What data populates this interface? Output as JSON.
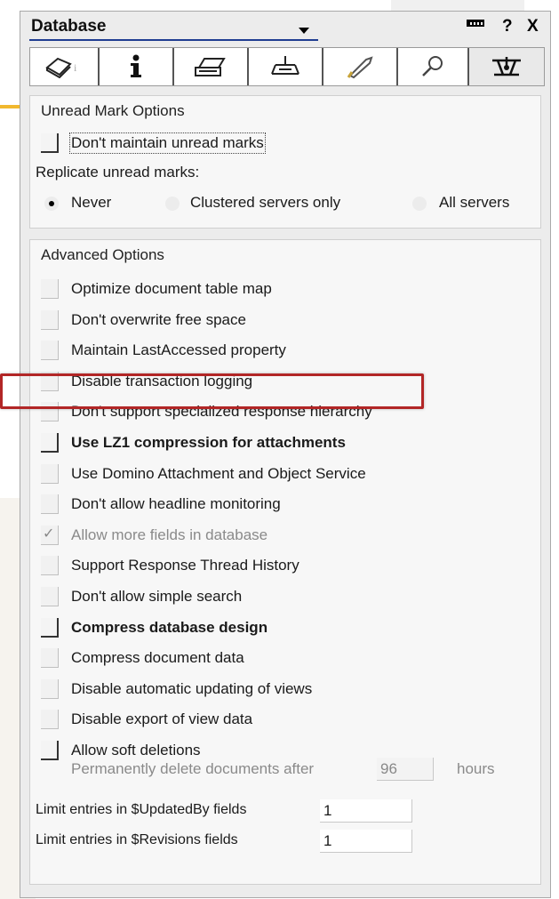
{
  "panel": {
    "title": "Database",
    "help_label": "?",
    "close_label": "X"
  },
  "tabs": [
    {
      "icon": "info-book-icon"
    },
    {
      "icon": "info-icon"
    },
    {
      "icon": "printer-icon"
    },
    {
      "icon": "design-icon"
    },
    {
      "icon": "launch-icon"
    },
    {
      "icon": "search-icon"
    },
    {
      "icon": "advanced-icon"
    }
  ],
  "unread": {
    "title": "Unread Mark Options",
    "dont_maintain": "Don't maintain unread marks",
    "replicate_label": "Replicate unread marks:",
    "radio_never": "Never",
    "radio_clustered": "Clustered servers only",
    "radio_all": "All servers",
    "selected": "Never"
  },
  "advanced": {
    "title": "Advanced Options",
    "options": [
      {
        "label": "Optimize document table map",
        "checked": false,
        "bold": false,
        "disabled": false
      },
      {
        "label": "Don't overwrite free space",
        "checked": false,
        "bold": false,
        "disabled": false
      },
      {
        "label": "Maintain LastAccessed property",
        "checked": false,
        "bold": false,
        "disabled": false
      },
      {
        "label": "Disable transaction logging",
        "checked": false,
        "bold": false,
        "disabled": false
      },
      {
        "label": "Don't support specialized response hierarchy",
        "checked": false,
        "bold": false,
        "disabled": false
      },
      {
        "label": "Use LZ1 compression for attachments",
        "checked": false,
        "bold": true,
        "disabled": false
      },
      {
        "label": "Use Domino Attachment and Object Service",
        "checked": false,
        "bold": false,
        "disabled": false
      },
      {
        "label": "Don't allow headline monitoring",
        "checked": false,
        "bold": false,
        "disabled": false
      },
      {
        "label": "Allow more fields in database",
        "checked": true,
        "bold": false,
        "disabled": true
      },
      {
        "label": "Support Response Thread History",
        "checked": false,
        "bold": false,
        "disabled": false
      },
      {
        "label": "Don't allow simple search",
        "checked": false,
        "bold": false,
        "disabled": false
      },
      {
        "label": "Compress database design",
        "checked": false,
        "bold": true,
        "disabled": false
      },
      {
        "label": "Compress document data",
        "checked": false,
        "bold": false,
        "disabled": false
      },
      {
        "label": "Disable automatic updating of views",
        "checked": false,
        "bold": false,
        "disabled": false
      },
      {
        "label": "Disable export of view data",
        "checked": false,
        "bold": false,
        "disabled": false
      },
      {
        "label": "Allow soft deletions",
        "checked": false,
        "bold": false,
        "disabled": false
      }
    ],
    "delete_after_label": "Permanently delete documents after",
    "delete_after_value": "96",
    "delete_after_unit": "hours",
    "updatedby_label": "Limit entries in $UpdatedBy fields",
    "updatedby_value": "1",
    "revisions_label": "Limit entries in $Revisions fields",
    "revisions_value": "1"
  }
}
